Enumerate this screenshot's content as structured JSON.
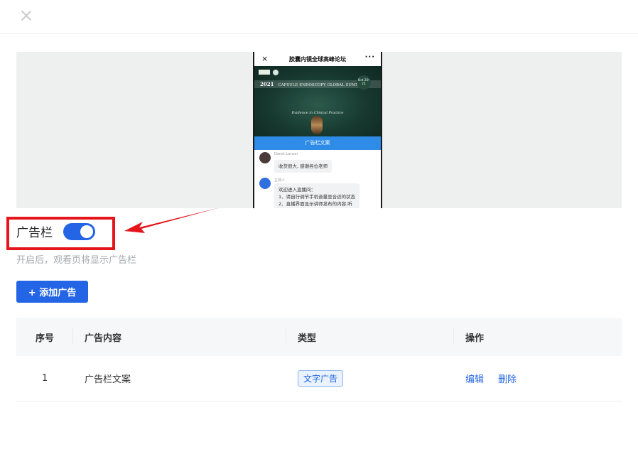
{
  "phone": {
    "title": "胶囊内镜全球高峰论坛",
    "close_icon": "×",
    "more_icon": "···",
    "banner_year": "2021",
    "banner_event": "CAPSULE ENDOSCOPY GLOBAL SUMMIT",
    "banner_date": "Oct 20-21",
    "banner_motto": "Evidence in Clinical Practice",
    "ad_text": "广告栏文案",
    "messages": [
      {
        "name": "Derek Larson",
        "text": "收货很大, 感谢各位老师"
      },
      {
        "name": "主持人",
        "text_lines": [
          "欢迎进入直播间：",
          "1、请自行调节手机音量至合适的状态",
          "2、直播界面显示讲师发布的内容,听"
        ]
      }
    ]
  },
  "settings": {
    "ad_label": "广告栏",
    "ad_enabled": true,
    "hint": "开启后，观看页将显示广告栏",
    "add_button": "+ 添加广告"
  },
  "table": {
    "headers": [
      "序号",
      "广告内容",
      "类型",
      "操作"
    ],
    "rows": [
      {
        "index": "1",
        "content": "广告栏文案",
        "type": "文字广告",
        "actions": [
          "编辑",
          "删除"
        ]
      }
    ]
  },
  "colors": {
    "primary": "#2465e5",
    "highlight": "#e5151b"
  }
}
